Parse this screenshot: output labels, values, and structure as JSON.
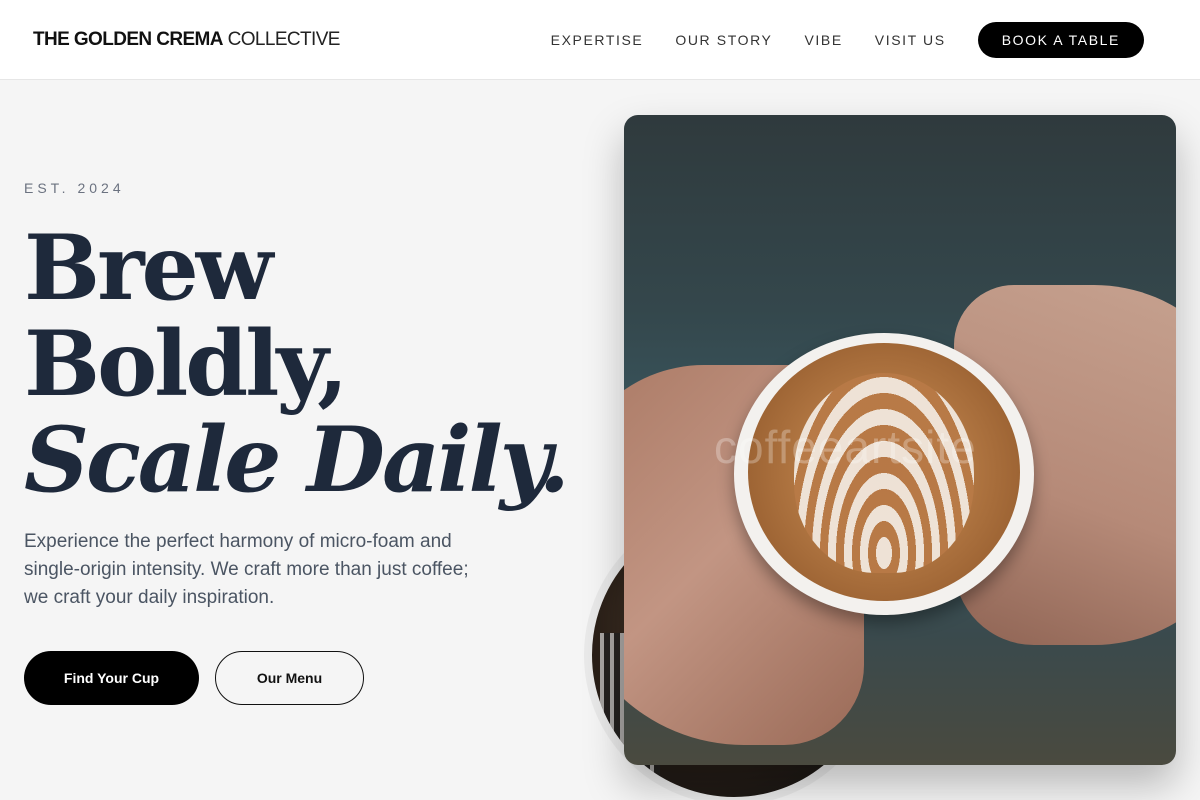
{
  "header": {
    "logo_bold": "THE GOLDEN CREMA",
    "logo_light": "COLLECTIVE",
    "nav": [
      "EXPERTISE",
      "OUR STORY",
      "VIBE",
      "VISIT US"
    ],
    "cta": "BOOK A TABLE"
  },
  "hero": {
    "eyebrow": "EST. 2024",
    "headline": [
      "Brew",
      "Boldly,",
      "Scale Daily."
    ],
    "lead": "Experience the perfect harmony of micro-foam and single-origin intensity. We craft more than just coffee; we craft your daily inspiration.",
    "primary_button": "Find Your Cup",
    "secondary_button": "Our Menu"
  },
  "images": {
    "watermark": "coffeeartsite"
  },
  "colors": {
    "ink": "#1e293b",
    "muted": "#4b5563",
    "button": "#000000",
    "background": "#f5f5f5"
  }
}
